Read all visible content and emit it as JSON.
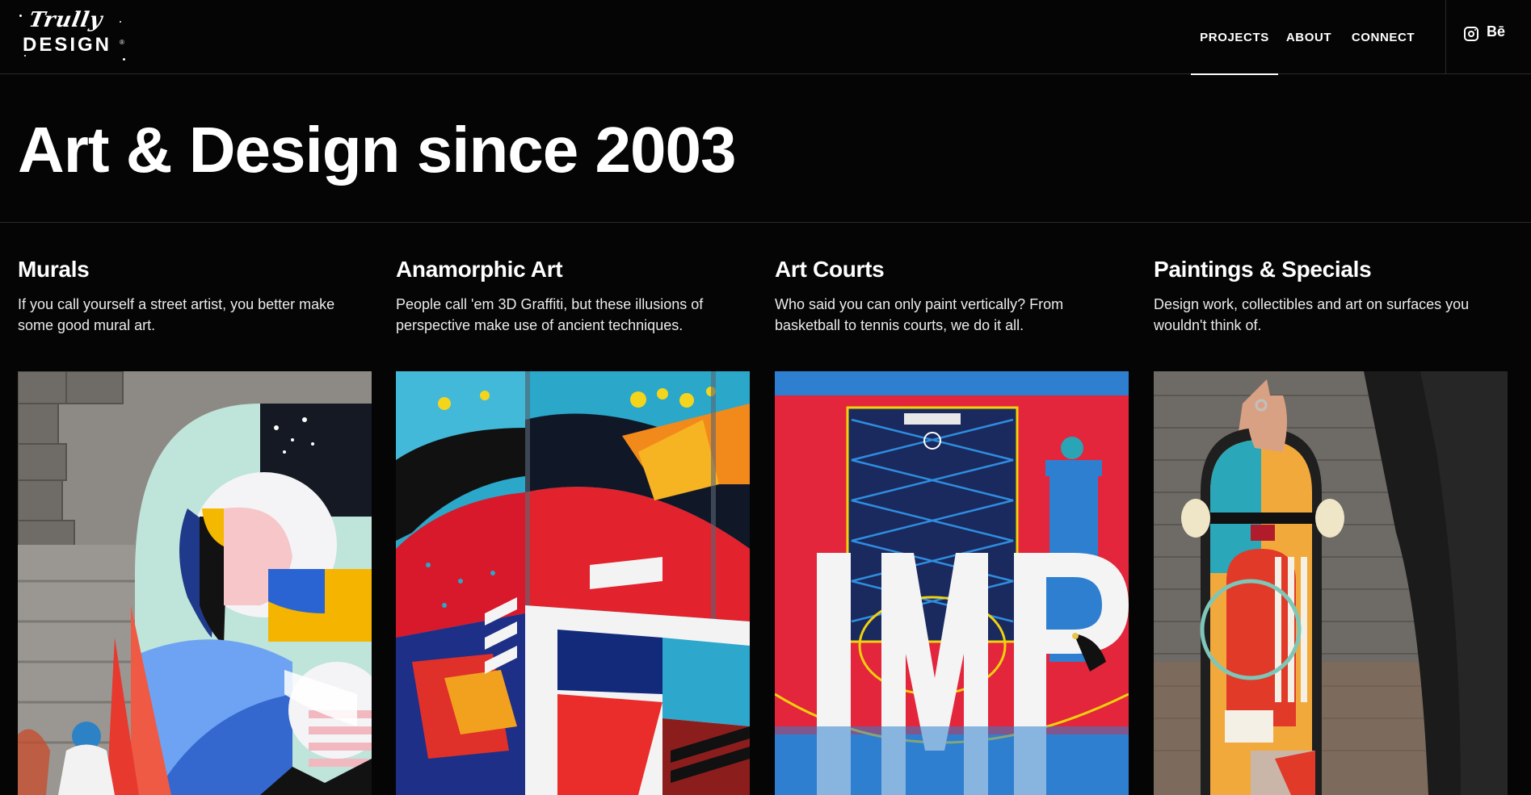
{
  "brand": {
    "logo_script": "Trully",
    "logo_word": "DESIGN",
    "logo_mark": "®"
  },
  "nav": {
    "items": [
      {
        "label": "PROJECTS",
        "active": true
      },
      {
        "label": "ABOUT",
        "active": false
      },
      {
        "label": "CONNECT",
        "active": false
      }
    ]
  },
  "social": {
    "instagram_icon": "instagram-icon",
    "behance_label": "Bē"
  },
  "hero": {
    "title": "Art & Design since 2003"
  },
  "categories": [
    {
      "title": "Murals",
      "description": "If you call yourself a street artist, you better make some good mural art.",
      "image_icon": "mural-image"
    },
    {
      "title": "Anamorphic Art",
      "description": "People call 'em 3D Graffiti, but these illusions of perspective make use of ancient techniques.",
      "image_icon": "anamorphic-image"
    },
    {
      "title": "Art Courts",
      "description": "Who said you can only paint vertically? From basketball to tennis courts, we do it all.",
      "image_icon": "art-court-image"
    },
    {
      "title": "Paintings & Specials",
      "description": "Design work, collectibles and art on surfaces you wouldn't think of.",
      "image_icon": "skateboard-image"
    }
  ],
  "colors": {
    "background": "#050505",
    "text": "#ffffff",
    "divider": "#2a2a2a"
  }
}
